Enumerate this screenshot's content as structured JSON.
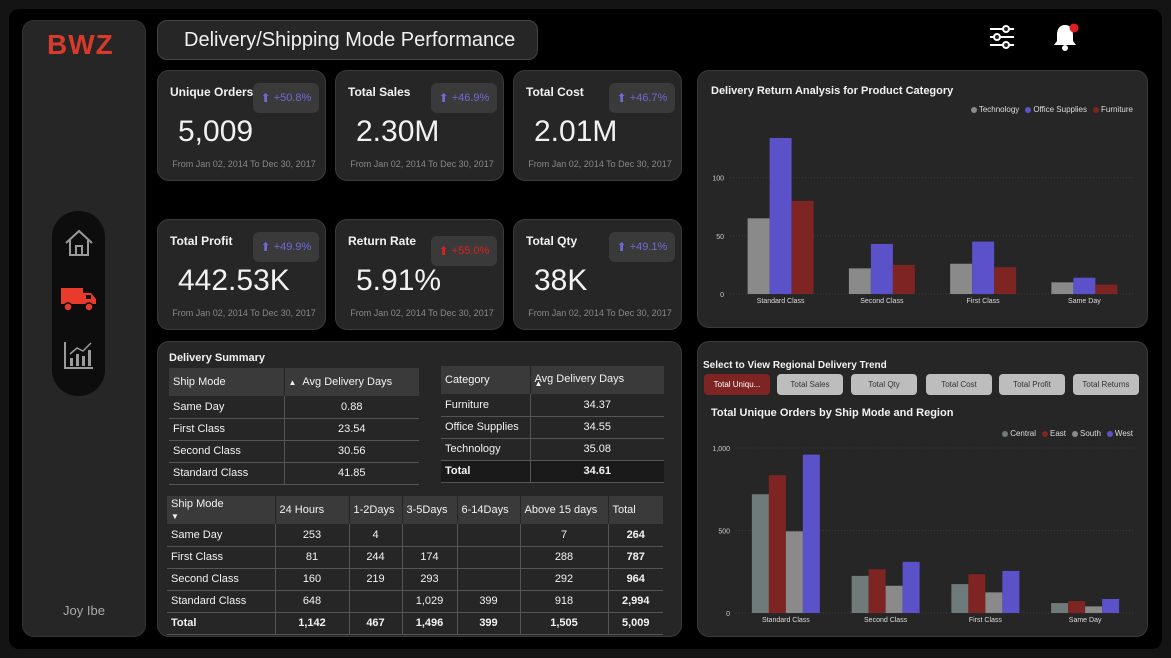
{
  "app": {
    "logo": "BWZ",
    "title": "Delivery/Shipping Mode Performance",
    "author": "Joy Ibe"
  },
  "nav": [
    "home-icon",
    "delivery-truck-icon",
    "analytics-chart-icon"
  ],
  "top_icons": [
    "filter-sliders-icon",
    "notification-bell-icon"
  ],
  "kpis": {
    "unique_orders": {
      "title": "Unique Orders",
      "value": "5,009",
      "change": "+50.8%",
      "period": "From Jan 02, 2014 To Dec 30, 2017"
    },
    "total_sales": {
      "title": "Total Sales",
      "value": "2.30M",
      "change": "+46.9%",
      "period": "From Jan 02, 2014 To Dec 30, 2017"
    },
    "total_cost": {
      "title": "Total Cost",
      "value": "2.01M",
      "change": "+46.7%",
      "period": "From Jan 02, 2014 To Dec 30, 2017"
    },
    "total_profit": {
      "title": "Total Profit",
      "value": "442.53K",
      "change": "+49.9%",
      "period": "From Jan 02, 2014 To Dec 30, 2017"
    },
    "return_rate": {
      "title": "Return Rate",
      "value": "5.91%",
      "change": "+55.0%",
      "period": "From Jan 02, 2014 To Dec 30, 2017"
    },
    "total_qty": {
      "title": "Total Qty",
      "value": "38K",
      "change": "+49.1%",
      "period": "From Jan 02, 2014 To Dec 30, 2017"
    }
  },
  "colors": {
    "accent": "#d83a2c",
    "up": "#6f6ad6",
    "down": "#e02020",
    "series_gray": "#8a8a8a",
    "series_blue": "#5b52c9",
    "series_red": "#7e2422",
    "series_slate": "#6f7b7b"
  },
  "delivery_summary": {
    "title": "Delivery Summary",
    "ship_table": {
      "headers": [
        "Ship Mode",
        "Avg Delivery Days"
      ],
      "rows": [
        [
          "Same Day",
          "0.88"
        ],
        [
          "First Class",
          "23.54"
        ],
        [
          "Second Class",
          "30.56"
        ],
        [
          "Standard Class",
          "41.85"
        ]
      ]
    },
    "category_table": {
      "headers": [
        "Category",
        "Avg Delivery Days"
      ],
      "rows": [
        [
          "Furniture",
          "34.37"
        ],
        [
          "Office Supplies",
          "34.55"
        ],
        [
          "Technology",
          "35.08"
        ]
      ],
      "total": [
        "Total",
        "34.61"
      ]
    },
    "matrix": {
      "headers": [
        "Ship Mode",
        "24 Hours",
        "1-2Days",
        "3-5Days",
        "6-14Days",
        "Above 15 days",
        "Total"
      ],
      "rows": [
        [
          "Same Day",
          "253",
          "4",
          "",
          "",
          "7",
          "264"
        ],
        [
          "First Class",
          "81",
          "244",
          "174",
          "",
          "288",
          "787"
        ],
        [
          "Second Class",
          "160",
          "219",
          "293",
          "",
          "292",
          "964"
        ],
        [
          "Standard Class",
          "648",
          "",
          "1,029",
          "399",
          "918",
          "2,994"
        ]
      ],
      "total": [
        "Total",
        "1,142",
        "467",
        "1,496",
        "399",
        "1,505",
        "5,009"
      ]
    }
  },
  "region_selector": {
    "title": "Select to View Regional Delivery Trend",
    "buttons": [
      "Total Uniqu...",
      "Total Sales",
      "Total Qty",
      "Total Cost",
      "Total Profit",
      "Total Returns"
    ],
    "selected": 0
  },
  "chart_data": [
    {
      "type": "bar",
      "title": "Delivery Return Analysis for Product Category",
      "categories": [
        "Standard Class",
        "Second Class",
        "First Class",
        "Same Day"
      ],
      "series": [
        {
          "name": "Technology",
          "values": [
            65,
            22,
            26,
            10
          ],
          "color": "#8a8a8a"
        },
        {
          "name": "Office Supplies",
          "values": [
            134,
            43,
            45,
            14
          ],
          "color": "#5b52c9"
        },
        {
          "name": "Furniture",
          "values": [
            80,
            25,
            23,
            8
          ],
          "color": "#7e2422"
        }
      ],
      "yticks": [
        0,
        50,
        100
      ],
      "ylim": [
        0,
        140
      ],
      "legend": "top-right",
      "grid": true
    },
    {
      "type": "bar",
      "title": "Total Unique Orders by Ship Mode and Region",
      "categories": [
        "Standard Class",
        "Second Class",
        "First Class",
        "Same Day"
      ],
      "series": [
        {
          "name": "Central",
          "values": [
            720,
            225,
            175,
            60
          ],
          "color": "#6f7b7b"
        },
        {
          "name": "East",
          "values": [
            835,
            265,
            235,
            72
          ],
          "color": "#7e2422"
        },
        {
          "name": "South",
          "values": [
            495,
            165,
            125,
            40
          ],
          "color": "#8a8a8a"
        },
        {
          "name": "West",
          "values": [
            960,
            310,
            255,
            85
          ],
          "color": "#5b52c9"
        }
      ],
      "yticks": [
        0,
        500,
        1000
      ],
      "ytick_labels": [
        "0",
        "500",
        "1,000"
      ],
      "ylim": [
        0,
        1000
      ],
      "legend": "top-right",
      "grid": true
    }
  ]
}
